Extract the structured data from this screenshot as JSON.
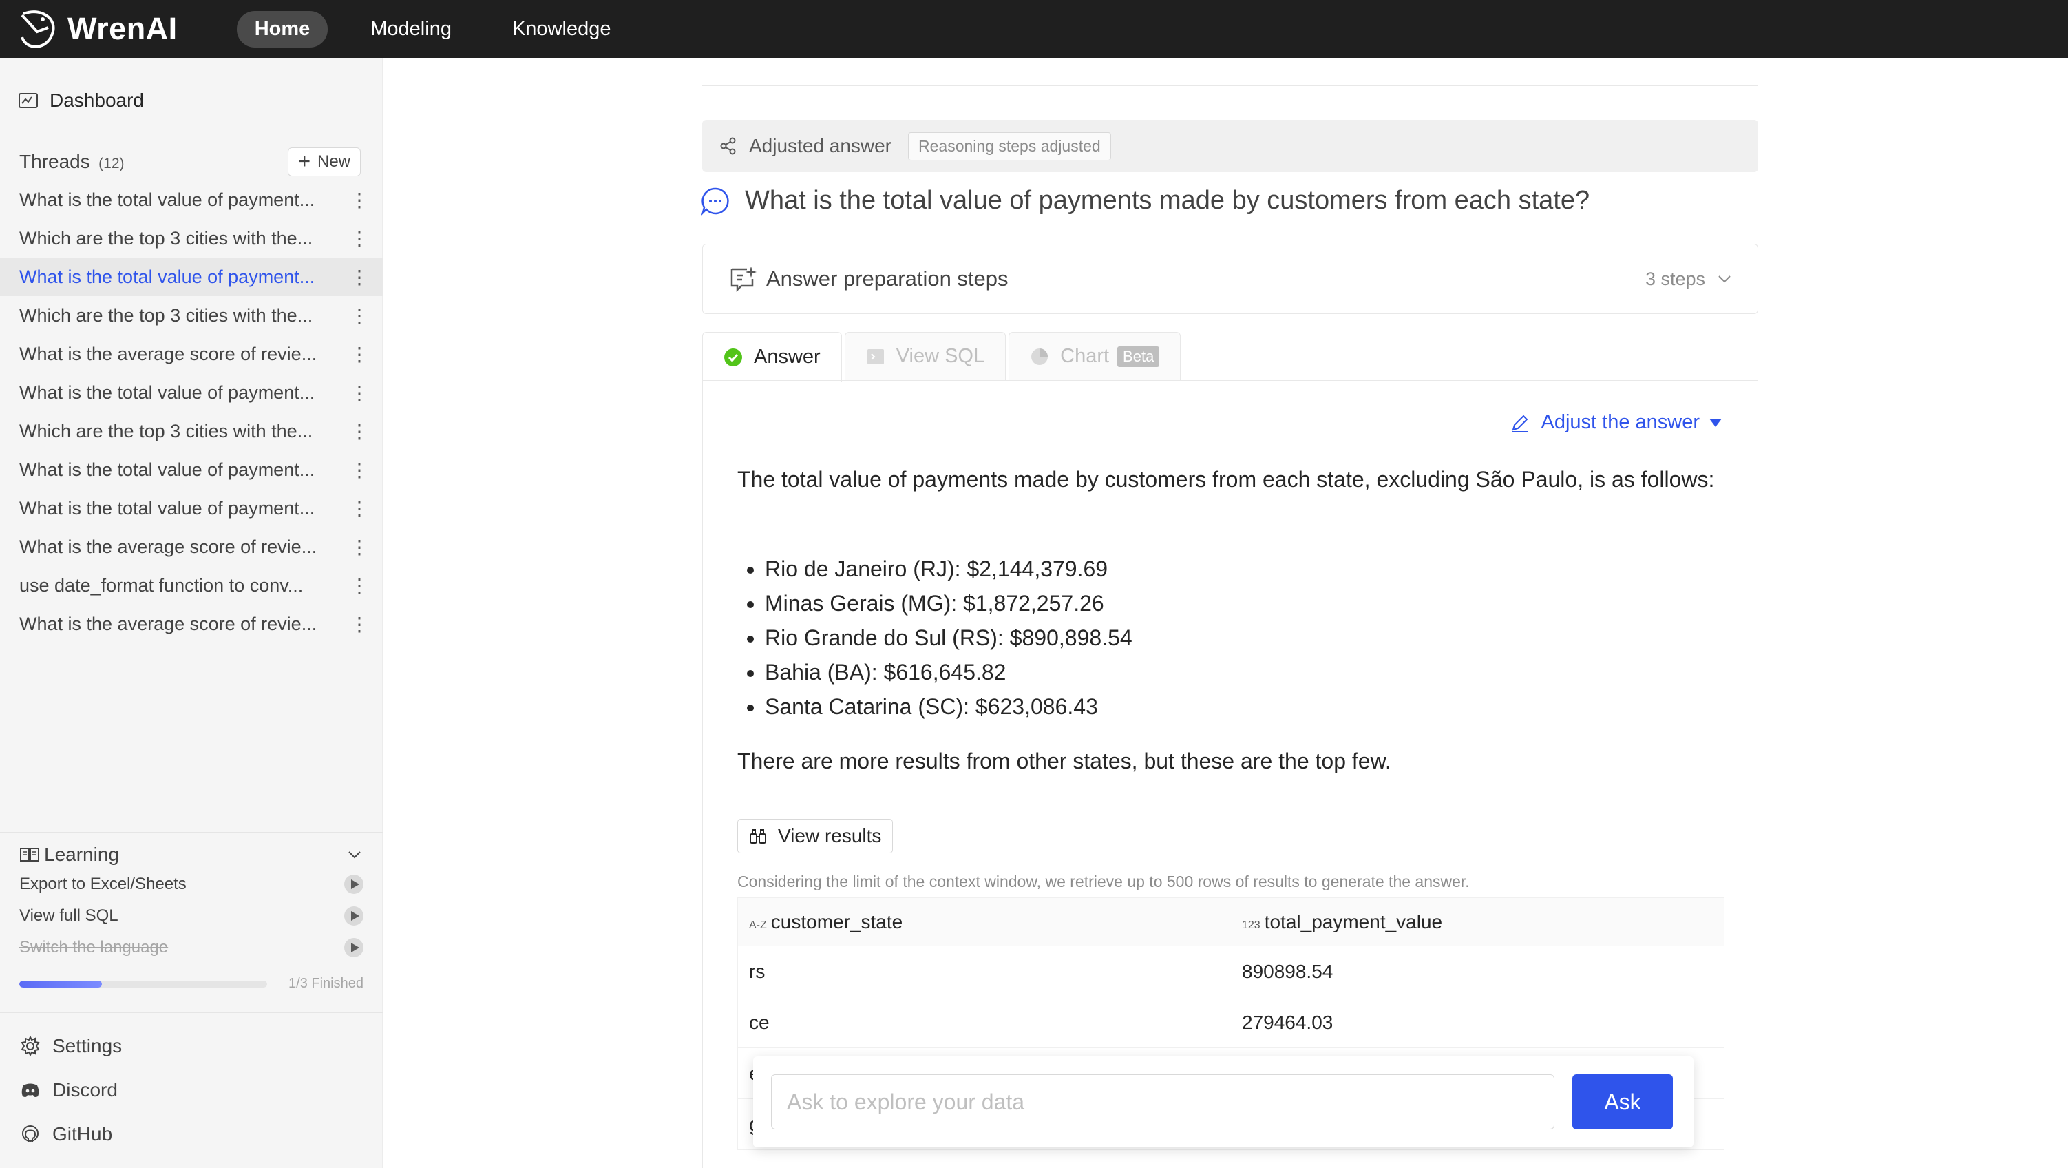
{
  "app": {
    "logo_text": "WrenAI",
    "nav": [
      {
        "label": "Home",
        "active": true
      },
      {
        "label": "Modeling",
        "active": false
      },
      {
        "label": "Knowledge",
        "active": false
      }
    ]
  },
  "sidebar": {
    "dashboard_label": "Dashboard",
    "threads_title": "Threads",
    "threads_count": "(12)",
    "new_label": "New",
    "threads": [
      {
        "label": "What is the total value of payment...",
        "active": false
      },
      {
        "label": "Which are the top 3 cities with the...",
        "active": false
      },
      {
        "label": "What is the total value of payment...",
        "active": true
      },
      {
        "label": "Which are the top 3 cities with the...",
        "active": false
      },
      {
        "label": "What is the average score of revie...",
        "active": false
      },
      {
        "label": "What is the total value of payment...",
        "active": false
      },
      {
        "label": "Which are the top 3 cities with the...",
        "active": false
      },
      {
        "label": "What is the total value of payment...",
        "active": false
      },
      {
        "label": "What is the total value of payment...",
        "active": false
      },
      {
        "label": "What is the average score of revie...",
        "active": false
      },
      {
        "label": "use date_format function to conv...",
        "active": false
      },
      {
        "label": "What is the average score of revie...",
        "active": false
      }
    ],
    "learning": {
      "title": "Learning",
      "items": [
        {
          "label": "Export to Excel/Sheets",
          "done": false
        },
        {
          "label": "View full SQL",
          "done": false
        },
        {
          "label": "Switch the language",
          "done": true
        }
      ],
      "progress": 0.333,
      "progress_label": "1/3 Finished"
    },
    "bottom_links": [
      "Settings",
      "Discord",
      "GitHub"
    ]
  },
  "main": {
    "adjusted_label": "Adjusted answer",
    "reasoning_tag": "Reasoning steps adjusted",
    "question": "What is the total value of payments made by customers from each state?",
    "prep_label": "Answer preparation steps",
    "prep_steps": "3 steps",
    "tabs": {
      "answer": "Answer",
      "sql": "View SQL",
      "chart": "Chart",
      "beta": "Beta"
    },
    "adjust_label": "Adjust the answer",
    "answer_intro": "The total value of payments made by customers from each state, excluding São Paulo, is as follows:",
    "answer_items": [
      "Rio de Janeiro (RJ): $2,144,379.69",
      "Minas Gerais (MG): $1,872,257.26",
      "Rio Grande do Sul (RS): $890,898.54",
      "Bahia (BA): $616,645.82",
      "Santa Catarina (SC): $623,086.43"
    ],
    "answer_outro": "There are more results from other states, but these are the top few.",
    "view_results_label": "View results",
    "context_note": "Considering the limit of the context window, we retrieve up to 500 rows of results to generate the answer.",
    "table": {
      "columns": [
        {
          "type": "A-Z",
          "name": "customer_state"
        },
        {
          "type": "123",
          "name": "total_payment_value"
        }
      ],
      "rows": [
        [
          "rs",
          "890898.54"
        ],
        [
          "ce",
          "279464.03"
        ],
        [
          "e",
          ""
        ],
        [
          "g",
          ""
        ]
      ]
    },
    "ask_placeholder": "Ask to explore your data",
    "ask_button": "Ask"
  },
  "colors": {
    "primary": "#2f54eb",
    "topbar": "#1f1f1f",
    "sidebar_bg": "#f5f5f5"
  }
}
